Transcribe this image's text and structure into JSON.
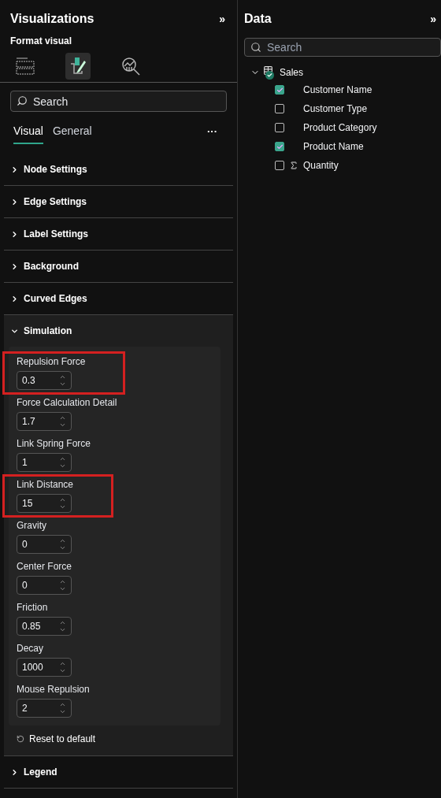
{
  "visualizations": {
    "title": "Visualizations",
    "collapse_glyph": "»",
    "subtitle": "Format visual",
    "format_icons": [
      {
        "kind": "fields",
        "selected": false
      },
      {
        "kind": "format",
        "selected": true
      },
      {
        "kind": "analytics",
        "selected": false
      }
    ],
    "search": {
      "placeholder": "Search"
    },
    "tabs": [
      {
        "label": "Visual",
        "selected": true
      },
      {
        "label": "General",
        "selected": false
      }
    ],
    "more": "···",
    "sections": [
      {
        "label": "Node Settings",
        "expanded": false
      },
      {
        "label": "Edge Settings",
        "expanded": false
      },
      {
        "label": "Label Settings",
        "expanded": false
      },
      {
        "label": "Background",
        "expanded": false
      },
      {
        "label": "Curved Edges",
        "expanded": false
      },
      {
        "label": "Simulation",
        "expanded": true,
        "fields": [
          {
            "label": "Repulsion Force",
            "value": "0.3",
            "highlighted": true
          },
          {
            "label": "Force Calculation Detail",
            "value": "1.7",
            "highlighted": false
          },
          {
            "label": "Link Spring Force",
            "value": "1",
            "highlighted": false
          },
          {
            "label": "Link Distance",
            "value": "15",
            "highlighted": true
          },
          {
            "label": "Gravity",
            "value": "0",
            "highlighted": false
          },
          {
            "label": "Center Force",
            "value": "0",
            "highlighted": false
          },
          {
            "label": "Friction",
            "value": "0.85",
            "highlighted": false
          },
          {
            "label": "Decay",
            "value": "1000",
            "highlighted": false
          },
          {
            "label": "Mouse Repulsion",
            "value": "2",
            "highlighted": false
          }
        ],
        "reset": "Reset to default"
      },
      {
        "label": "Legend",
        "expanded": false
      }
    ]
  },
  "data": {
    "title": "Data",
    "collapse_glyph": "»",
    "search": {
      "placeholder": "Search"
    },
    "tables": [
      {
        "name": "Sales",
        "expanded": true,
        "fields": [
          {
            "name": "Customer Name",
            "checked": true,
            "kind": "text"
          },
          {
            "name": "Customer Type",
            "checked": false,
            "kind": "text"
          },
          {
            "name": "Product Category",
            "checked": false,
            "kind": "text"
          },
          {
            "name": "Product Name",
            "checked": true,
            "kind": "text"
          },
          {
            "name": "Quantity",
            "checked": false,
            "kind": "sum"
          }
        ]
      }
    ]
  }
}
